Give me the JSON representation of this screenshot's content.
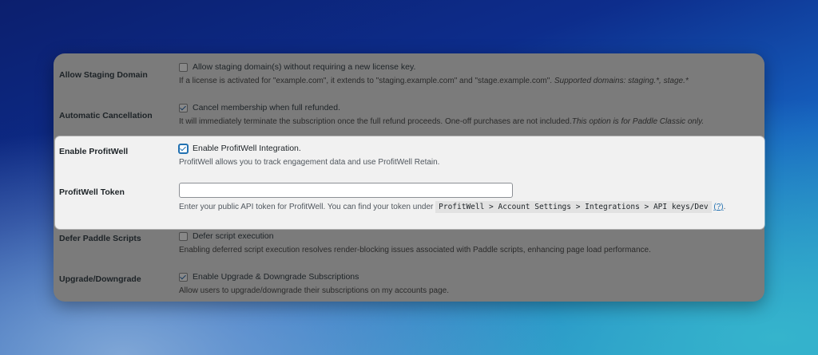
{
  "rows": [
    {
      "label": "Allow Staging Domain",
      "checkbox_label": "Allow staging domain(s) without requiring a new license key.",
      "checked": false,
      "description": "If a license is activated for \"example.com\", it extends to \"staging.example.com\" and \"stage.example.com\". ",
      "description_italic": "Supported domains: staging.*, stage.*"
    },
    {
      "label": "Automatic Cancellation",
      "checkbox_label": "Cancel membership when full refunded.",
      "checked": true,
      "description": "It will immediately terminate the subscription once the full refund proceeds. One-off purchases are not included.",
      "description_italic": "This option is for Paddle Classic only."
    },
    {
      "label": "Enable ProfitWell",
      "checkbox_label": "Enable ProfitWell Integration.",
      "checked": true,
      "description": "ProfitWell allows you to track engagement data and use ProfitWell Retain."
    },
    {
      "label": "ProfitWell Token",
      "input_value": "",
      "description": "Enter your public API token for ProfitWell. You can find your token under ",
      "code": "ProfitWell > Account Settings > Integrations > API keys/Dev",
      "help_link": "(?)",
      "suffix": "."
    },
    {
      "label": "Defer Paddle Scripts",
      "checkbox_label": "Defer script execution",
      "checked": false,
      "description": "Enabling deferred script execution resolves render-blocking issues associated with Paddle scripts, enhancing page load performance."
    },
    {
      "label": "Upgrade/Downgrade",
      "checkbox_label": "Enable Upgrade & Downgrade Subscriptions",
      "checked": true,
      "description": "Allow users to upgrade/downgrade their subscriptions on my accounts page."
    }
  ]
}
